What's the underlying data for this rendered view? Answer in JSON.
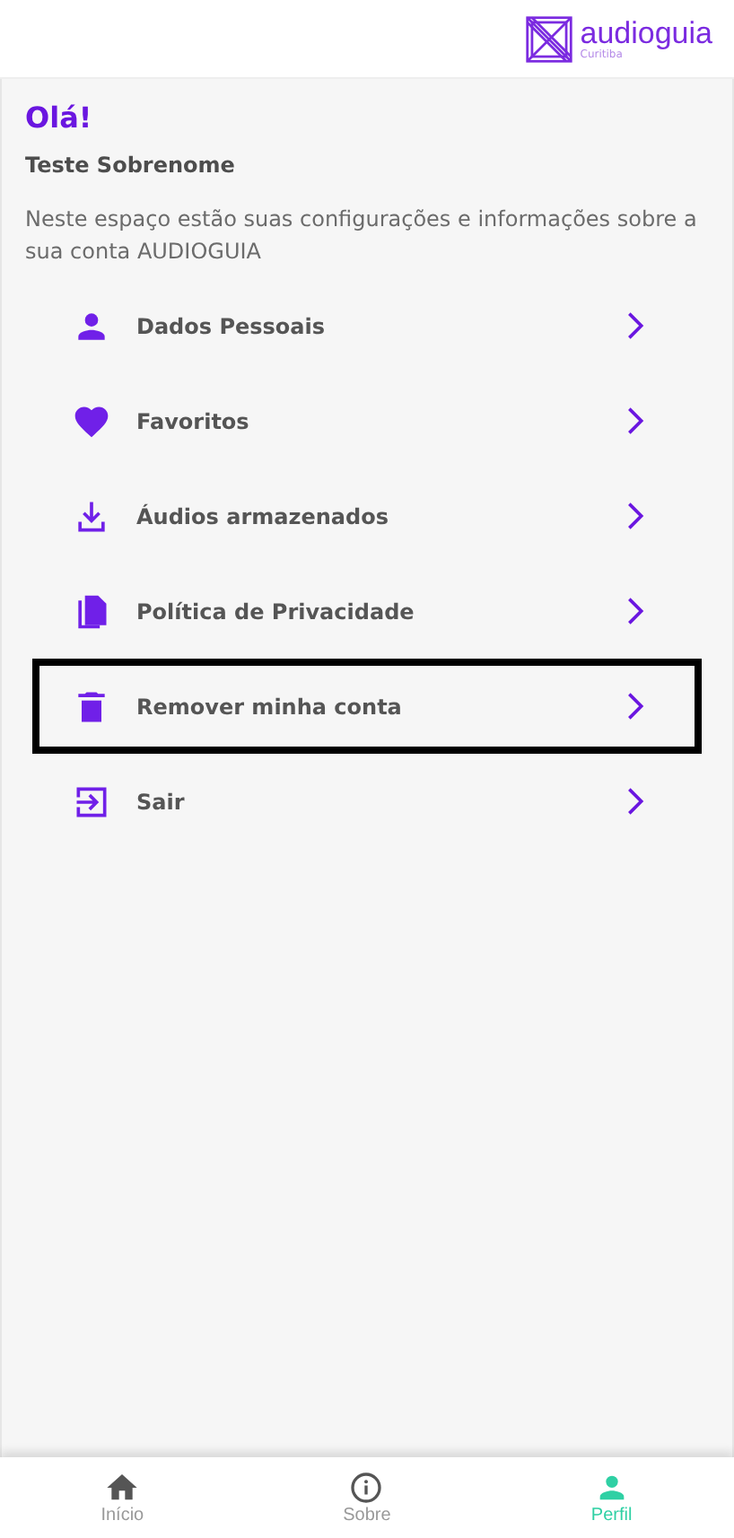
{
  "header": {
    "logo_name": "audioguia",
    "logo_city": "Curitiba"
  },
  "greeting": "Olá!",
  "user_name": "Teste Sobrenome",
  "description": "Neste espaço estão suas configurações e informações sobre a sua conta AUDIOGUIA",
  "menu": [
    {
      "label": "Dados Pessoais",
      "kind": "person",
      "highlighted": false
    },
    {
      "label": "Favoritos",
      "kind": "heart",
      "highlighted": false
    },
    {
      "label": "Áudios armazenados",
      "kind": "download",
      "highlighted": false
    },
    {
      "label": "Política de Privacidade",
      "kind": "documents",
      "highlighted": false
    },
    {
      "label": "Remover minha conta",
      "kind": "trash",
      "highlighted": true
    },
    {
      "label": "Sair",
      "kind": "exit",
      "highlighted": false
    }
  ],
  "bottom_nav": [
    {
      "label": "Início",
      "kind": "home",
      "selected": false
    },
    {
      "label": "Sobre",
      "kind": "info",
      "selected": false
    },
    {
      "label": "Perfil",
      "kind": "person",
      "selected": true
    }
  ]
}
